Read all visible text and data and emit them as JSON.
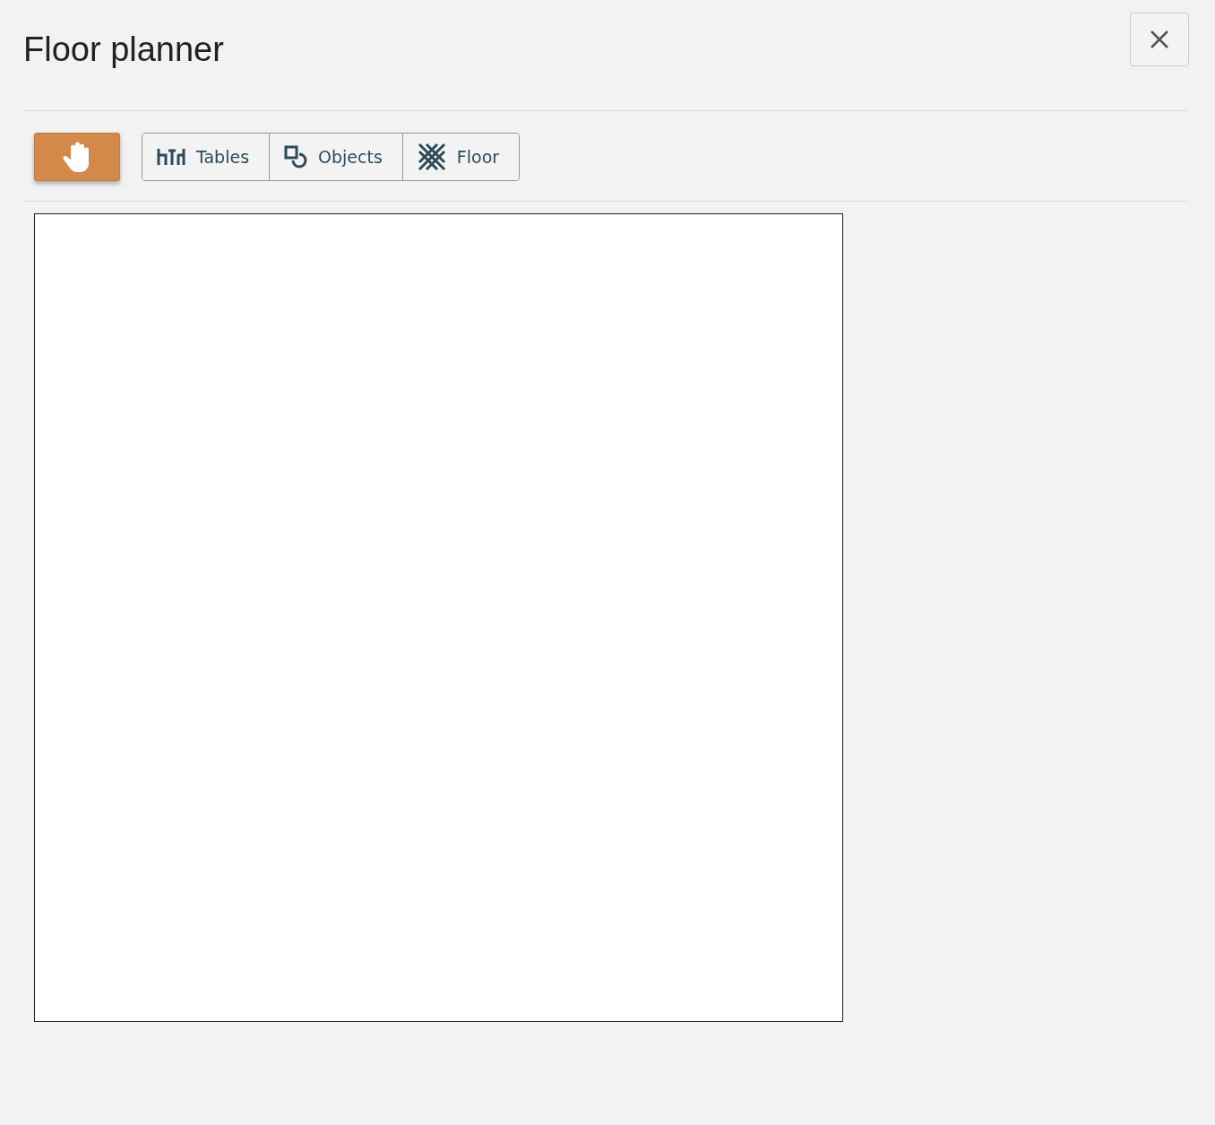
{
  "window": {
    "title": "Floor planner"
  },
  "tools": [
    {
      "kind": "hand",
      "selected": true
    }
  ],
  "modes": [
    {
      "kind": "tables",
      "label": "Tables",
      "selected": false
    },
    {
      "kind": "objects",
      "label": "Objects",
      "selected": false
    },
    {
      "kind": "floor",
      "label": "Floor",
      "selected": false
    }
  ]
}
